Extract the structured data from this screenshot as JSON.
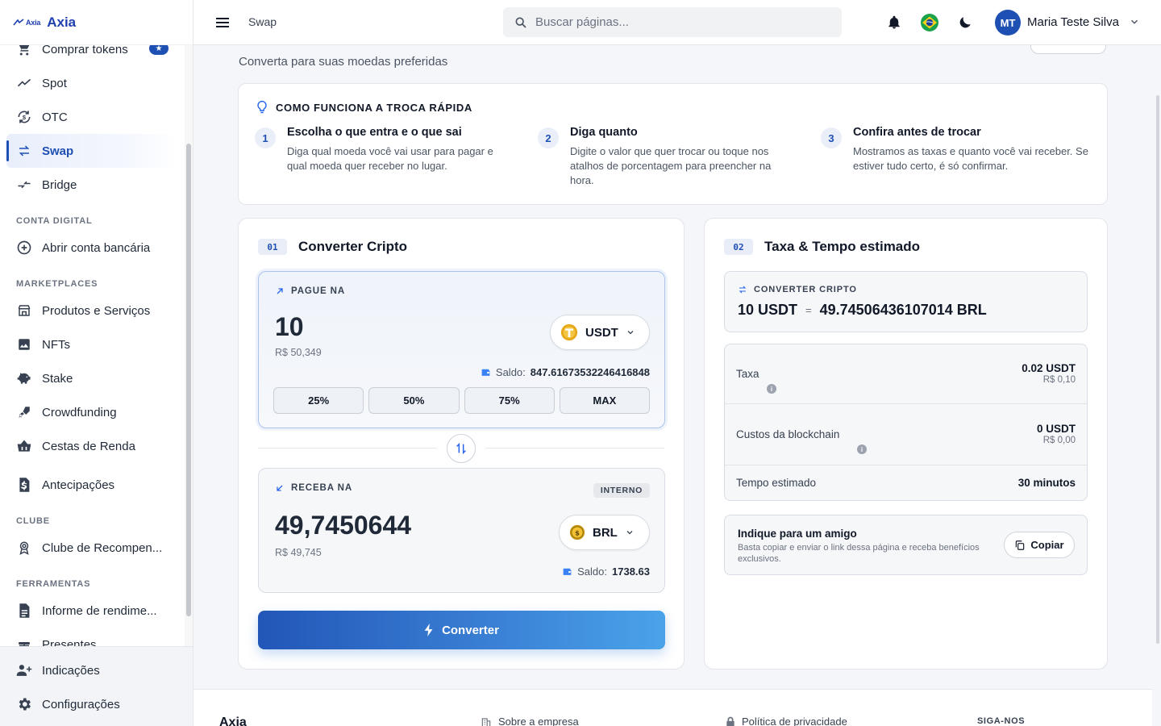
{
  "brand": {
    "logo_small": "Axia",
    "name": "Axia"
  },
  "sidebar": {
    "items": [
      {
        "label": "Comprar tokens",
        "icon": "cart-icon",
        "badge": "★"
      },
      {
        "label": "Spot",
        "icon": "trend-icon"
      },
      {
        "label": "OTC",
        "icon": "otc-icon"
      },
      {
        "label": "Swap",
        "icon": "swap-icon",
        "active": true
      },
      {
        "label": "Bridge",
        "icon": "bridge-icon"
      }
    ],
    "sections": [
      {
        "title": "CONTA DIGITAL",
        "items": [
          {
            "label": "Abrir conta bancária",
            "icon": "plus-circle-icon"
          }
        ]
      },
      {
        "title": "MARKETPLACES",
        "items": [
          {
            "label": "Produtos e Serviços",
            "icon": "store-icon"
          },
          {
            "label": "NFTs",
            "icon": "image-icon"
          },
          {
            "label": "Stake",
            "icon": "piggy-icon"
          },
          {
            "label": "Crowdfunding",
            "icon": "rocket-icon"
          },
          {
            "label": "Cestas de Renda",
            "icon": "basket-icon"
          },
          {
            "label": "Antecipações",
            "icon": "invoice-icon"
          }
        ]
      },
      {
        "title": "CLUBE",
        "items": [
          {
            "label": "Clube de Recompen...",
            "icon": "award-icon"
          }
        ]
      },
      {
        "title": "FERRAMENTAS",
        "items": [
          {
            "label": "Informe de rendime...",
            "icon": "report-icon"
          },
          {
            "label": "Presentes",
            "icon": "gift-icon"
          }
        ]
      }
    ],
    "bottom": [
      {
        "label": "Indicações",
        "icon": "users-plus-icon"
      },
      {
        "label": "Configurações",
        "icon": "gear-icon"
      }
    ]
  },
  "header": {
    "breadcrumb": "Swap",
    "search_placeholder": "Buscar páginas...",
    "user_initials": "MT",
    "user_name": "Maria Teste Silva"
  },
  "page": {
    "subtitle": "Converta para suas moedas preferidas"
  },
  "how_it_works": {
    "title": "COMO FUNCIONA A TROCA RÁPIDA",
    "steps": [
      {
        "num": "1",
        "title": "Escolha o que entra e o que sai",
        "desc": "Diga qual moeda você vai usar para pagar e qual moeda quer receber no lugar."
      },
      {
        "num": "2",
        "title": "Diga quanto",
        "desc": "Digite o valor que quer trocar ou toque nos atalhos de porcentagem para preencher na hora."
      },
      {
        "num": "3",
        "title": "Confira antes de trocar",
        "desc": "Mostramos as taxas e quanto você vai receber. Se estiver tudo certo, é só confirmar."
      }
    ]
  },
  "converter": {
    "num": "01",
    "title": "Converter Cripto",
    "pay_label": "PAGUE NA",
    "pay_amount": "10",
    "pay_fiat": "R$ 50,349",
    "pay_token": "USDT",
    "pay_saldo_label": "Saldo:",
    "pay_saldo": "847.61673532246416848",
    "pct_buttons": [
      "25%",
      "50%",
      "75%",
      "MAX"
    ],
    "receive_label": "RECEBA NA",
    "receive_badge": "INTERNO",
    "receive_amount": "49,7450644",
    "receive_fiat": "R$ 49,745",
    "receive_token": "BRL",
    "receive_saldo_label": "Saldo:",
    "receive_saldo": "1738.63",
    "convert_button": "Converter"
  },
  "fees": {
    "num": "02",
    "title": "Taxa & Tempo estimado",
    "rate_label": "CONVERTER CRIPTO",
    "rate_from": "10 USDT",
    "rate_eq": "=",
    "rate_to": "49.74506436107014 BRL",
    "rows": [
      {
        "label": "Taxa",
        "value": "0.02 USDT",
        "sub": "R$ 0,10"
      },
      {
        "label": "Custos da blockchain",
        "value": "0 USDT",
        "sub": "R$ 0,00"
      },
      {
        "label": "Tempo estimado",
        "value": "30 minutos"
      }
    ],
    "referral_title": "Indique para um amigo",
    "referral_desc": "Basta copiar e enviar o link dessa página e receba benefícios exclusivos.",
    "copy_button": "Copiar"
  },
  "footer": {
    "brand": "Axia",
    "about": "Sobre a empresa",
    "privacy": "Política de privacidade",
    "follow": "SIGA-NOS"
  }
}
